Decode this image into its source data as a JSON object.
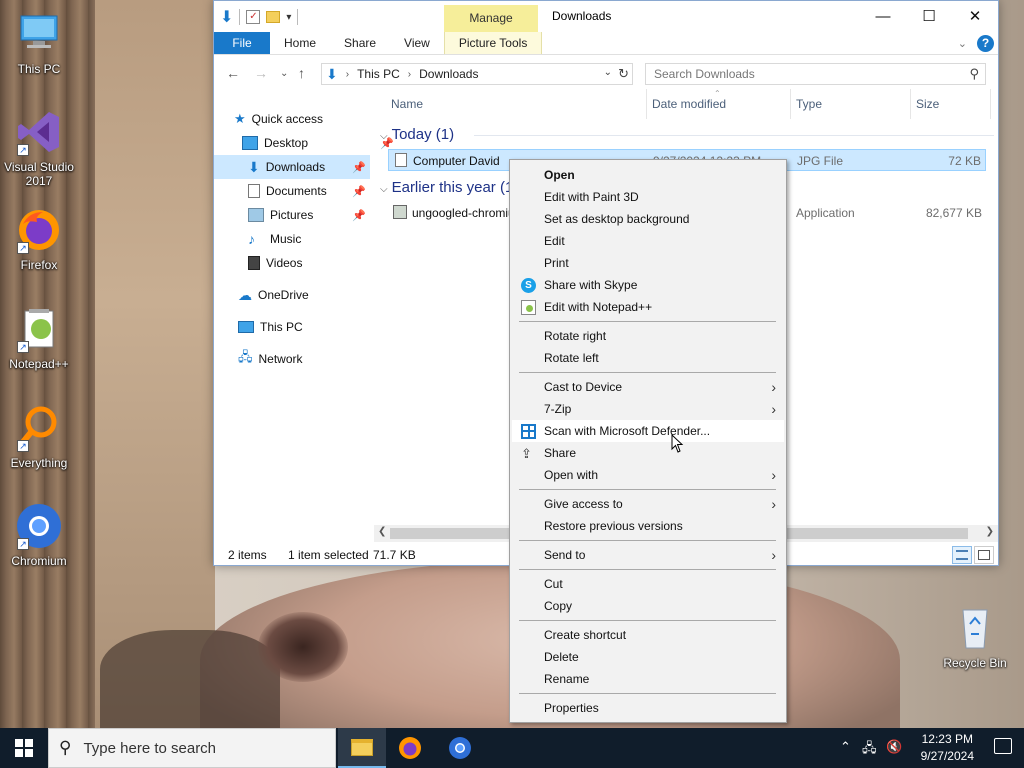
{
  "desktop": {
    "icons": [
      {
        "label": "This PC",
        "icon": "this-pc-icon"
      },
      {
        "label": "Visual Studio 2017",
        "icon": "visual-studio-icon"
      },
      {
        "label": "Firefox",
        "icon": "firefox-icon"
      },
      {
        "label": "Notepad++",
        "icon": "notepadpp-icon"
      },
      {
        "label": "Everything",
        "icon": "everything-icon"
      },
      {
        "label": "Chromium",
        "icon": "chromium-icon"
      },
      {
        "label": "Recycle Bin",
        "icon": "recycle-bin-icon"
      }
    ]
  },
  "explorer": {
    "title": "Downloads",
    "contextual_tab": "Manage",
    "ribbon_tabs": [
      "File",
      "Home",
      "Share",
      "View",
      "Picture Tools"
    ],
    "breadcrumb": [
      "This PC",
      "Downloads"
    ],
    "search_placeholder": "Search Downloads",
    "nav": {
      "quick_access": "Quick access",
      "items": [
        "Desktop",
        "Downloads",
        "Documents",
        "Pictures",
        "Music",
        "Videos"
      ],
      "onedrive": "OneDrive",
      "this_pc": "This PC",
      "network": "Network"
    },
    "columns": [
      "Name",
      "Date modified",
      "Type",
      "Size"
    ],
    "groups": [
      {
        "label": "Today (1)"
      },
      {
        "label": "Earlier this year (1)"
      }
    ],
    "files": [
      {
        "name": "Computer David",
        "date": "9/27/2024 12:23 PM",
        "type": "JPG File",
        "size": "72 KB",
        "selected": true
      },
      {
        "name": "ungoogled-chromium",
        "date": "",
        "type": "Application",
        "size": "82,677 KB",
        "selected": false
      }
    ],
    "status": {
      "items": "2 items",
      "selection": "1 item selected",
      "size": "71.7 KB"
    }
  },
  "context_menu": {
    "items": [
      {
        "label": "Open",
        "bold": true
      },
      {
        "label": "Edit with Paint 3D"
      },
      {
        "label": "Set as desktop background"
      },
      {
        "label": "Edit"
      },
      {
        "label": "Print"
      },
      {
        "label": "Share with Skype",
        "icon": "skype-icon"
      },
      {
        "label": "Edit with Notepad++",
        "icon": "notepadpp-icon"
      },
      {
        "label": "Rotate right"
      },
      {
        "label": "Rotate left"
      },
      {
        "label": "Cast to Device",
        "submenu": true
      },
      {
        "label": "7-Zip",
        "submenu": true
      },
      {
        "label": "Scan with Microsoft Defender...",
        "icon": "defender-icon",
        "hover": true
      },
      {
        "label": "Share",
        "icon": "share-icon"
      },
      {
        "label": "Open with",
        "submenu": true
      },
      {
        "label": "Give access to",
        "submenu": true
      },
      {
        "label": "Restore previous versions"
      },
      {
        "label": "Send to",
        "submenu": true
      },
      {
        "label": "Cut"
      },
      {
        "label": "Copy"
      },
      {
        "label": "Create shortcut"
      },
      {
        "label": "Delete"
      },
      {
        "label": "Rename"
      },
      {
        "label": "Properties"
      }
    ]
  },
  "taskbar": {
    "search_placeholder": "Type here to search",
    "time": "12:23 PM",
    "date": "9/27/2024"
  },
  "colors": {
    "accent": "#1979ca",
    "selection": "#cce8ff",
    "taskbar": "#101d2b",
    "manage_tab": "#f6ee9a"
  }
}
